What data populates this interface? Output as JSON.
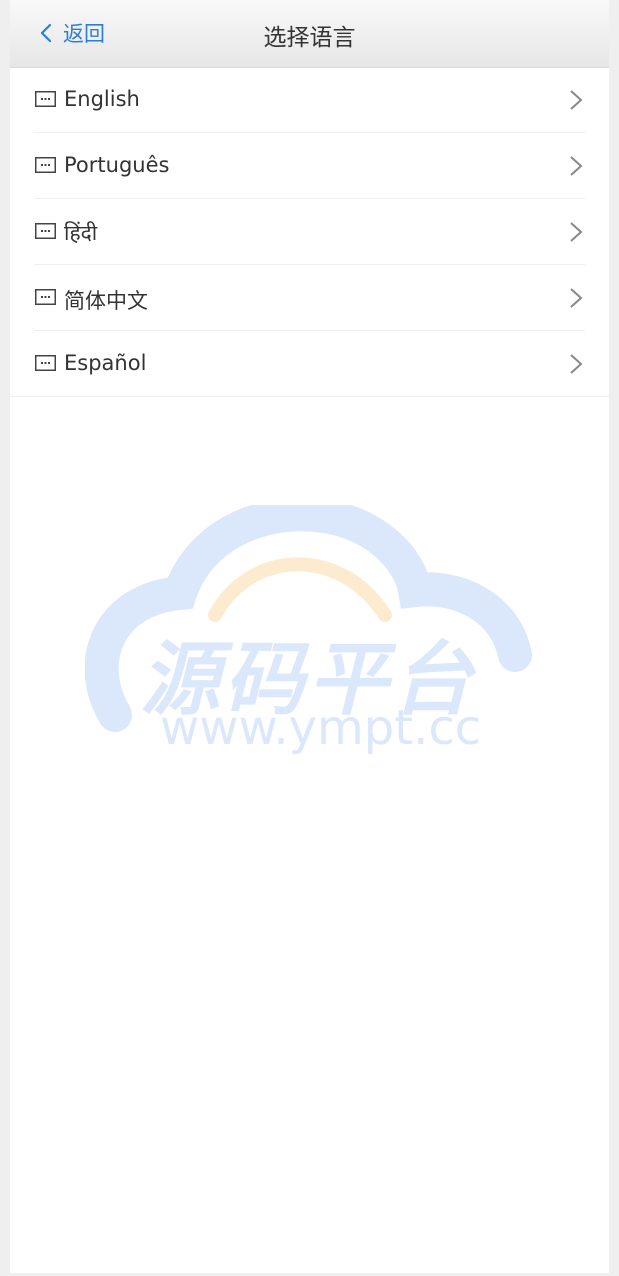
{
  "navbar": {
    "back_label": "返回",
    "title": "选择语言"
  },
  "languages": [
    {
      "label": "English",
      "icon": "keyboard-icon"
    },
    {
      "label": "Português",
      "icon": "keyboard-icon"
    },
    {
      "label": "हिंदी",
      "icon": "keyboard-icon"
    },
    {
      "label": "简体中文",
      "icon": "keyboard-icon"
    },
    {
      "label": "Español",
      "icon": "keyboard-icon"
    }
  ],
  "watermark": {
    "text": "源码平台",
    "url": "www.ympt.cc"
  },
  "colors": {
    "accent": "#2b7dd8",
    "text": "#333333",
    "watermark_blue": "#dbe7fb",
    "watermark_orange": "#fdebd0"
  }
}
